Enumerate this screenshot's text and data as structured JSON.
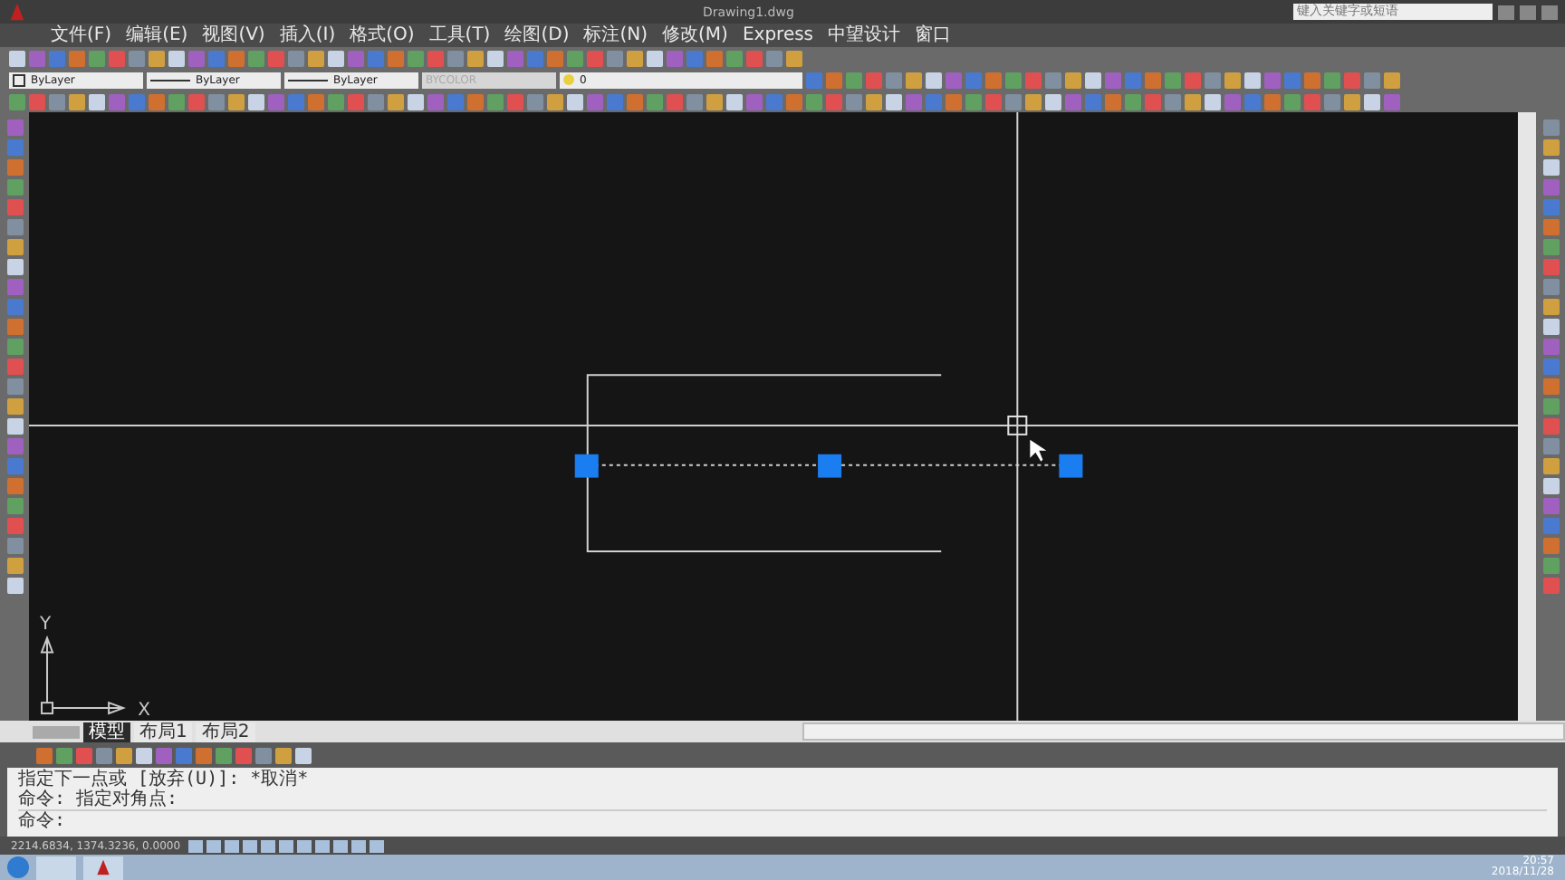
{
  "window": {
    "title": "Drawing1.dwg"
  },
  "search": {
    "placeholder": "键入关键字或短语"
  },
  "menu": [
    "文件(F)",
    "编辑(E)",
    "视图(V)",
    "插入(I)",
    "格式(O)",
    "工具(T)",
    "绘图(D)",
    "标注(N)",
    "修改(M)",
    "Express",
    "中望设计",
    "窗口"
  ],
  "properties": {
    "layer": "0",
    "color_setting": "ByLayer",
    "linetype": "ByLayer",
    "lineweight": "ByLayer",
    "plot_style": {
      "value": "BYCOLOR",
      "disabled": true
    }
  },
  "ucs": {
    "x_label": "X",
    "y_label": "Y"
  },
  "layout_tabs": [
    {
      "label": "模型",
      "selected": true
    },
    {
      "label": "布局1",
      "selected": false
    },
    {
      "label": "布局2",
      "selected": false
    }
  ],
  "command_history": [
    "指定下一点或 [放弃(U)]: *取消*",
    "命令: 指定对角点:"
  ],
  "command_prompt": "命令:",
  "coordinates": "2214.6834, 1374.3236, 0.0000",
  "taskbar": {
    "time": "20:57",
    "date": "2018/11/28"
  }
}
